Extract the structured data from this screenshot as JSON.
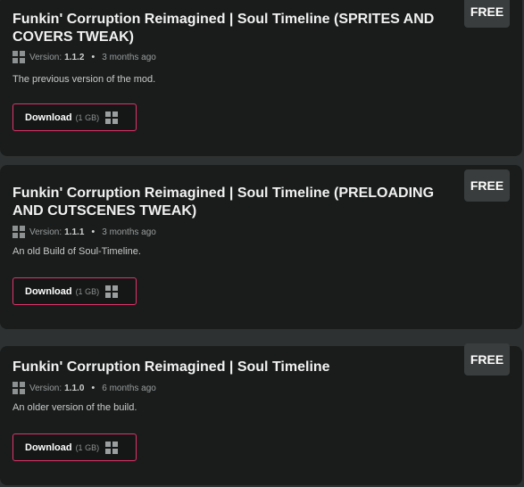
{
  "cards": [
    {
      "title": "Funkin' Corruption Reimagined | Soul Timeline (SPRITES AND COVERS TWEAK)",
      "badge": "FREE",
      "version_label": "Version:",
      "version": "1.1.2",
      "dot": "•",
      "age": "3 months ago",
      "description": "The previous version of the mod.",
      "download_label": "Download",
      "size": "(1 GB)",
      "platform_icon": "windows-icon"
    },
    {
      "title": "Funkin' Corruption Reimagined | Soul Timeline (PRELOADING AND CUTSCENES TWEAK)",
      "badge": "FREE",
      "version_label": "Version:",
      "version": "1.1.1",
      "dot": "•",
      "age": "3 months ago",
      "description": "An old Build of Soul-Timeline.",
      "download_label": "Download",
      "size": "(1 GB)",
      "platform_icon": "windows-icon"
    },
    {
      "title": "Funkin' Corruption Reimagined | Soul Timeline",
      "badge": "FREE",
      "version_label": "Version:",
      "version": "1.1.0",
      "dot": "•",
      "age": "6 months ago",
      "description": "An older version of the build.",
      "download_label": "Download",
      "size": "(1 GB)",
      "platform_icon": "windows-icon"
    }
  ],
  "colors": {
    "page_background": "#2e3131",
    "card_background": "#1a1c1c",
    "badge_background": "#3a3d3d",
    "download_border": "#e0336b"
  }
}
